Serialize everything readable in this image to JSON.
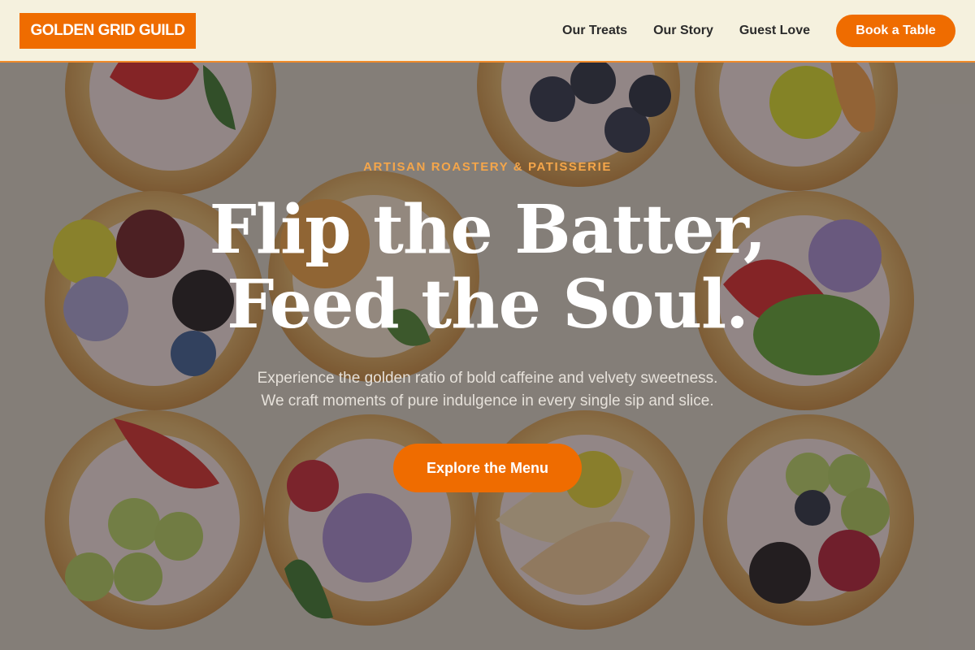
{
  "brand": {
    "name": "GOLDEN GRID GUILD",
    "accent_color": "#ef6c00"
  },
  "nav": {
    "links": [
      "Our Treats",
      "Our Story",
      "Guest Love"
    ],
    "cta_label": "Book a Table"
  },
  "hero": {
    "eyebrow": "ARTISAN ROASTERY & PATISSERIE",
    "headline_line1": "Flip the Batter,",
    "headline_line2": "Feed the Soul.",
    "subtext_line1": "Experience the golden ratio of bold caffeine and velvety sweetness.",
    "subtext_line2": "We craft moments of pure indulgence in every single sip and slice.",
    "cta_label": "Explore the Menu",
    "background_image": "fruit-tarts-photo"
  }
}
